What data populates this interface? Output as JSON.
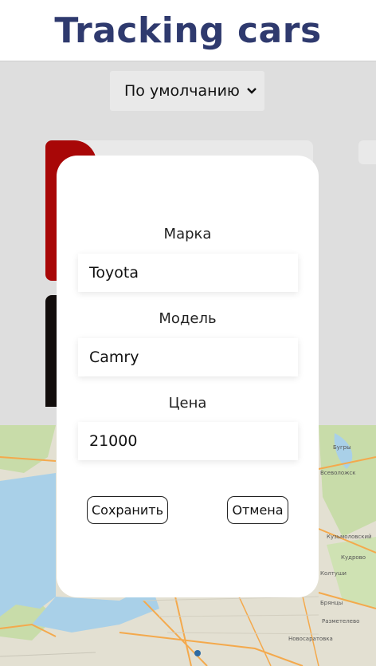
{
  "header": {
    "title": "Tracking cars"
  },
  "sort": {
    "selected": "По умолчанию",
    "chevron_icon": "chevron-down-icon"
  },
  "cards": [
    {
      "accent_color": "#a80707"
    },
    {
      "accent_color": "#120d0c"
    }
  ],
  "modal": {
    "fields": [
      {
        "label": "Марка",
        "value": "Toyota"
      },
      {
        "label": "Модель",
        "value": "Camry"
      },
      {
        "label": "Цена",
        "value": "21000"
      }
    ],
    "save_label": "Сохранить",
    "cancel_label": "Отмена"
  },
  "map": {
    "labels": [
      "Всеволожск",
      "Кудрово",
      "Колтуши",
      "Разметелево",
      "Кузьмоловский",
      "Новосаратовка",
      "Бугры",
      "Брянцы"
    ]
  },
  "colors": {
    "title": "#2f3a6e",
    "water": "#a9d0e8",
    "road": "#f4a94c",
    "park": "#c8dca9"
  }
}
